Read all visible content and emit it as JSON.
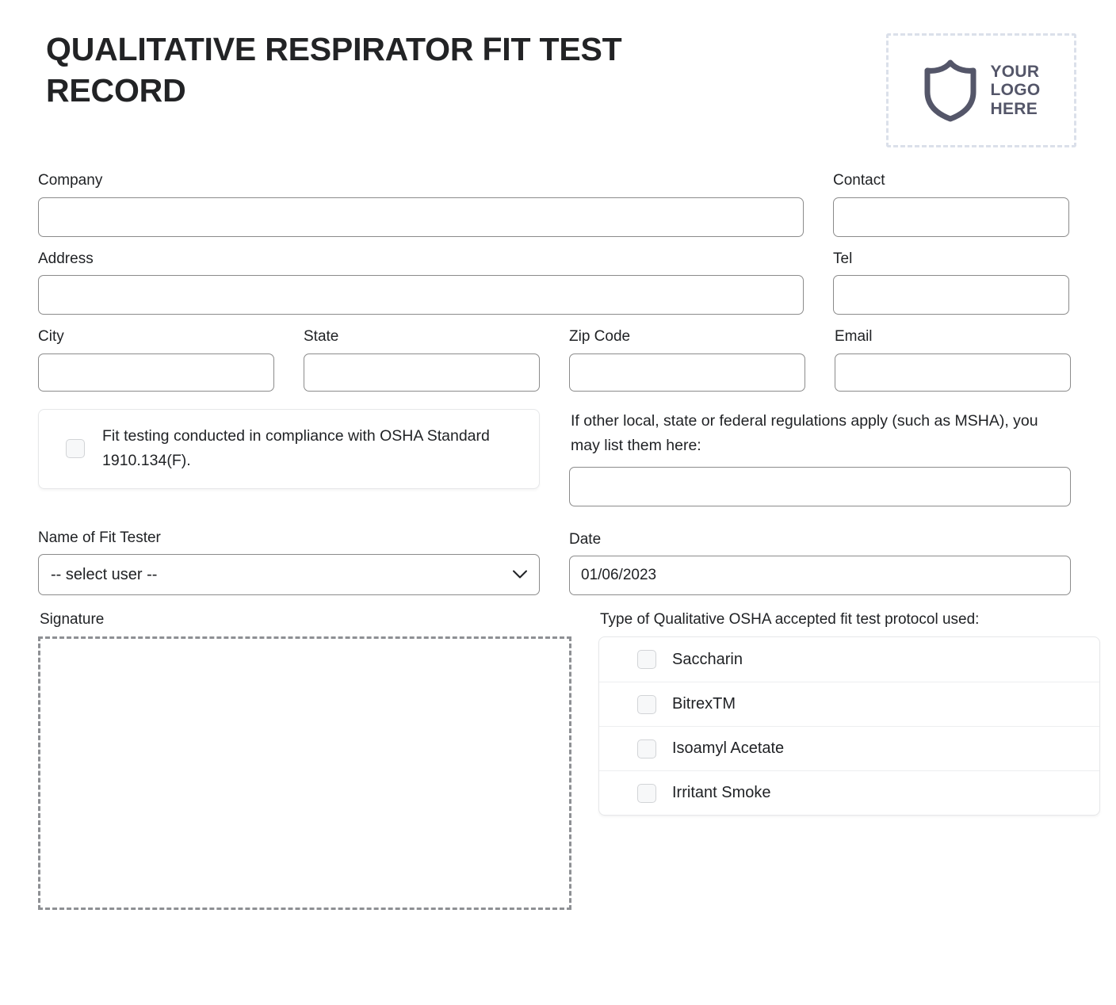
{
  "header": {
    "title": "QUALITATIVE RESPIRATOR FIT TEST RECORD",
    "logo": {
      "line1": "YOUR",
      "line2": "LOGO",
      "line3": "HERE",
      "icon": "shield-icon",
      "color": "#545669",
      "border_color": "#dbe0ea"
    }
  },
  "form": {
    "company": {
      "label": "Company",
      "value": "",
      "placeholder": ""
    },
    "contact": {
      "label": "Contact",
      "value": "",
      "placeholder": ""
    },
    "address": {
      "label": "Address",
      "value": "",
      "placeholder": ""
    },
    "tel": {
      "label": "Tel",
      "value": "",
      "placeholder": ""
    },
    "city": {
      "label": "City",
      "value": "",
      "placeholder": ""
    },
    "state": {
      "label": "State",
      "value": "",
      "placeholder": ""
    },
    "zip": {
      "label": "Zip Code",
      "value": "",
      "placeholder": ""
    },
    "email": {
      "label": "Email",
      "value": "",
      "placeholder": ""
    },
    "compliance": {
      "text": "Fit testing conducted in compliance with OSHA Standard 1910.134(F).",
      "checked": false
    },
    "other_regulations": {
      "text": "If other local, state or federal regulations apply (such as MSHA), you may list them here:",
      "value": "",
      "placeholder": ""
    },
    "fit_tester": {
      "label": "Name of Fit Tester",
      "selected": "-- select user --",
      "options": [
        "-- select user --"
      ]
    },
    "date": {
      "label": "Date",
      "value": "01/06/2023"
    },
    "signature": {
      "label": "Signature",
      "value": ""
    },
    "protocol": {
      "label": "Type of Qualitative OSHA accepted fit test protocol used:",
      "items": [
        {
          "label": "Saccharin",
          "checked": false
        },
        {
          "label": "BitrexTM",
          "checked": false
        },
        {
          "label": "Isoamyl Acetate",
          "checked": false
        },
        {
          "label": "Irritant Smoke",
          "checked": false
        }
      ]
    }
  }
}
